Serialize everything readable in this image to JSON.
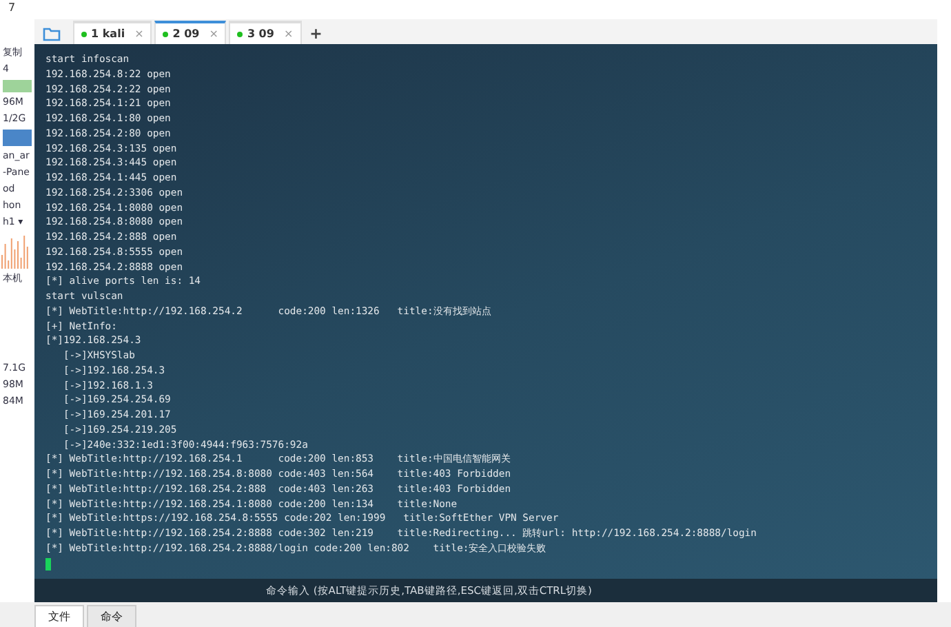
{
  "page_number": "7",
  "tabs": [
    {
      "label": "1 kali",
      "selected": false,
      "close": "×"
    },
    {
      "label": "2 09",
      "selected": true,
      "close": "×"
    },
    {
      "label": "3 09",
      "selected": false,
      "close": "×"
    }
  ],
  "new_tab": "+",
  "side_fragments": [
    {
      "kind": "text",
      "text": "复制"
    },
    {
      "kind": "text",
      "text": "4"
    },
    {
      "kind": "bar"
    },
    {
      "kind": "text",
      "text": "96M"
    },
    {
      "kind": "text",
      "text": "1/2G"
    },
    {
      "kind": "highlight"
    },
    {
      "kind": "text",
      "text": "an_ar"
    },
    {
      "kind": "text",
      "text": "-Pane"
    },
    {
      "kind": "text",
      "text": "od"
    },
    {
      "kind": "text",
      "text": "hon"
    },
    {
      "kind": "text",
      "text": "h1 ▾"
    },
    {
      "kind": "chart"
    },
    {
      "kind": "text",
      "text": "本机"
    },
    {
      "kind": "gap"
    },
    {
      "kind": "text",
      "text": "7.1G"
    },
    {
      "kind": "text",
      "text": "98M"
    },
    {
      "kind": "text",
      "text": "84M"
    }
  ],
  "terminal_lines": [
    "start infoscan",
    "192.168.254.8:22 open",
    "192.168.254.2:22 open",
    "192.168.254.1:21 open",
    "192.168.254.1:80 open",
    "192.168.254.2:80 open",
    "192.168.254.3:135 open",
    "192.168.254.3:445 open",
    "192.168.254.1:445 open",
    "192.168.254.2:3306 open",
    "192.168.254.1:8080 open",
    "192.168.254.8:8080 open",
    "192.168.254.2:888 open",
    "192.168.254.8:5555 open",
    "192.168.254.2:8888 open",
    "[*] alive ports len is: 14",
    "start vulscan",
    "[*] WebTitle:http://192.168.254.2      code:200 len:1326   title:没有找到站点",
    "[+] NetInfo:",
    "[*]192.168.254.3",
    "   [->]XHSYSlab",
    "   [->]192.168.254.3",
    "   [->]192.168.1.3",
    "   [->]169.254.254.69",
    "   [->]169.254.201.17",
    "   [->]169.254.219.205",
    "   [->]240e:332:1ed1:3f00:4944:f963:7576:92a",
    "[*] WebTitle:http://192.168.254.1      code:200 len:853    title:中国电信智能网关",
    "[*] WebTitle:http://192.168.254.8:8080 code:403 len:564    title:403 Forbidden",
    "[*] WebTitle:http://192.168.254.2:888  code:403 len:263    title:403 Forbidden",
    "[*] WebTitle:http://192.168.254.1:8080 code:200 len:134    title:None",
    "[*] WebTitle:https://192.168.254.8:5555 code:202 len:1999   title:SoftEther VPN Server",
    "[*] WebTitle:http://192.168.254.2:8888 code:302 len:219    title:Redirecting... 跳转url: http://192.168.254.2:8888/login",
    "[*] WebTitle:http://192.168.254.2:8888/login code:200 len:802    title:安全入口校验失败"
  ],
  "command_hint": "命令输入 (按ALT键提示历史,TAB键路径,ESC键返回,双击CTRL切换)",
  "bottom_tabs": [
    {
      "label": "文件",
      "selected": true
    },
    {
      "label": "命令",
      "selected": false
    }
  ]
}
